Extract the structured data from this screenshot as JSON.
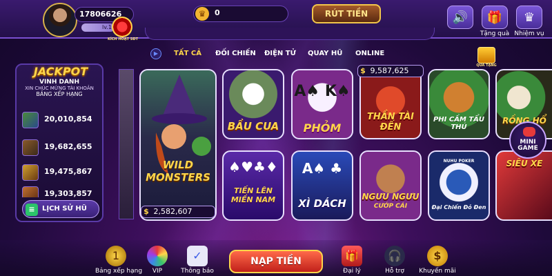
{
  "header": {
    "user_id": "17806626",
    "level": "lv.1",
    "activate_badge": "KÍCH HOẠT SĐT",
    "balance": "0",
    "withdraw_label": "RÚT TIỀN",
    "icons": [
      {
        "name": "sound-icon",
        "glyph": "🔊",
        "label": ""
      },
      {
        "name": "gift-icon",
        "glyph": "🎁",
        "label": "Tặng quà"
      },
      {
        "name": "crown-icon",
        "glyph": "♛",
        "label": "Nhiệm vụ"
      }
    ]
  },
  "categories": [
    {
      "label": "TẤT CẢ",
      "active": true
    },
    {
      "label": "ĐỐI CHIẾN",
      "active": false
    },
    {
      "label": "ĐIỆN TỬ",
      "active": false
    },
    {
      "label": "QUAY HŨ",
      "active": false
    },
    {
      "label": "ONLINE",
      "active": false
    }
  ],
  "jackpot": {
    "title": "JACKPOT",
    "honor_title": "VINH DANH",
    "honor_sub": "XIN CHÚC MỪNG TÀI KHOẢN",
    "leaderboard": "BẢNG XẾP HẠNG",
    "rows": [
      {
        "value": "20,010,854",
        "thumb": "APES GO WILD"
      },
      {
        "value": "19,682,655",
        "thumb": "TUYỆT ĐỈA LƯƠNG SƠN"
      },
      {
        "value": "19,475,867",
        "thumb": "SCAN TREASURE"
      },
      {
        "value": "19,303,857",
        "thumb": ""
      }
    ],
    "history_label": "LỊCH SỬ HŨ"
  },
  "games": {
    "wild_monsters": {
      "title": "WILD MONSTERS",
      "jackpot": "2,582,607"
    },
    "bau_cua": {
      "title": "BẦU CUA"
    },
    "phom": {
      "title": "PHỎM"
    },
    "than_tai": {
      "title": "THẦN TÀI ĐẾN",
      "jackpot": "9,587,625"
    },
    "phi_cam": {
      "title": "PHI CẦM TẨU THÚ"
    },
    "rong_ho": {
      "title": "RỒNG HỔ"
    },
    "tien_len": {
      "title": "TIẾN LÊN MIỀN NAM"
    },
    "xi_dach": {
      "title": "XÌ DÁCH"
    },
    "nguu_nguu": {
      "title": "NGƯU NGƯU",
      "subtitle": "CƯỚP CÁI"
    },
    "dai_chien": {
      "title": "Đại Chiến Đỏ Đen",
      "chip": "NUHU POKER"
    },
    "sieu_xe": {
      "title": "SIÊU XE"
    }
  },
  "gift_label": "QUÀ TẶNG",
  "mini_game": "MINI GAME",
  "bottom": {
    "ranking": "Bảng xếp hạng",
    "vip": "VIP",
    "notice": "Thông báo",
    "deposit": "NẠP TIỀN",
    "agent": "Đại lý",
    "support": "Hỗ trợ",
    "promo": "Khuyến mãi"
  }
}
